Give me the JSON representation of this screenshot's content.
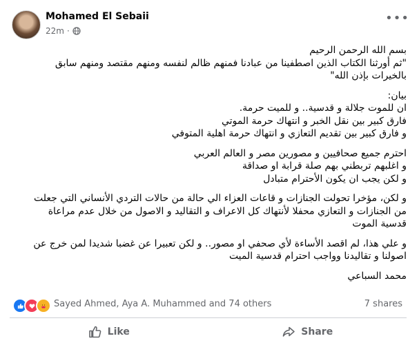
{
  "post": {
    "author": "Mohamed El Sebaii",
    "time": "22m",
    "paragraphs": [
      [
        "بسم الله الرحمن الرحيم",
        "\"ثم أورثنا الكتاب الذين اصطفينا من عبادنا فمنهم ظالم لنفسه ومنهم مقتصد ومنهم سابق",
        "بالخيرات بإذن الله\""
      ],
      [
        "بيان:",
        "ان للموت جلالة و قدسية.. و للميت حرمة.",
        "فارق كبير بين نقل الخبر و انتهاك حرمة الموتي",
        "و فارق كبير بين تقديم التعازي و انتهاك حرمة اهلية المتوفي"
      ],
      [
        "احترم جميع صحافيين و مصورين مصر و العالم العربي",
        "و اغلبهم تربطني بهم صلة قرابة او صداقة",
        "و لكن يجب ان يكون الأحترام متبادل"
      ],
      [
        "و لكن، مؤخرا تحولت الجنازات و قاعات العزاء الي حالة من حالات التردي الأنساني التي جعلت",
        "من الجنازات و التعازي محفلا لأنتهاك كل الاعراف و التقاليد و الاصول من خلال عدم مراعاة",
        "قدسية الموت"
      ],
      [
        "و علي هذا، لم اقصد الأساءة لأي صحفي او مصور.. و لكن تعبيرا عن غضبا شديدا لمن خرج عن",
        "اصولنا و تقاليدنا وواجب احترام قدسية الميت"
      ],
      [
        "محمد السباعي"
      ]
    ]
  },
  "reactions": {
    "names": "Sayed Ahmed, Aya A. Muhammed and 74 others",
    "shares": "7 shares",
    "icons": [
      "like-icon",
      "love-icon",
      "care-icon"
    ]
  },
  "actions": {
    "like": "Like",
    "share": "Share"
  }
}
